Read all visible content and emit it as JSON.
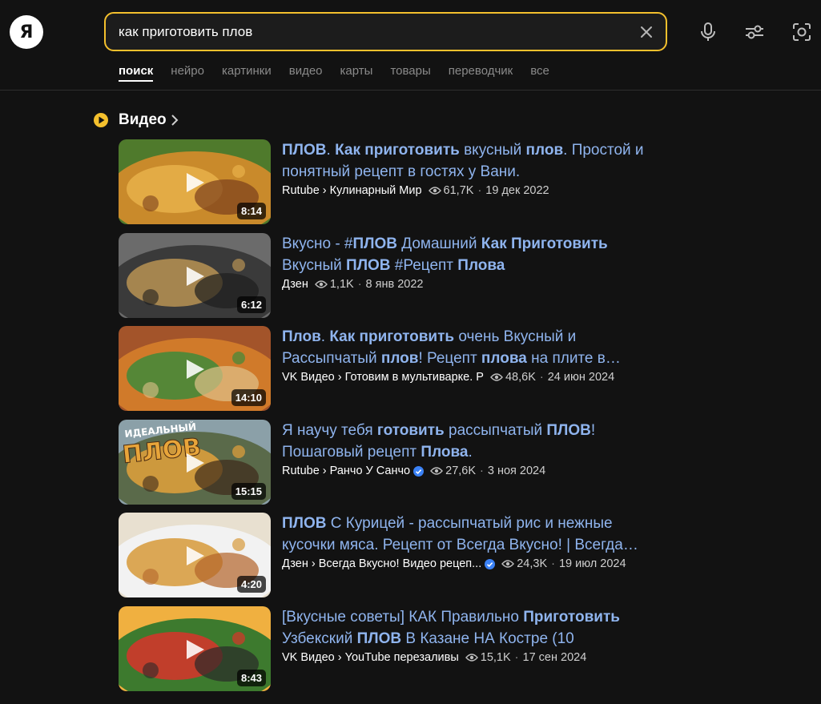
{
  "header": {
    "logo_letter": "Я",
    "search_value": "как приготовить плов"
  },
  "tabs": [
    {
      "label": "поиск",
      "active": true
    },
    {
      "label": "нейро",
      "active": false
    },
    {
      "label": "картинки",
      "active": false
    },
    {
      "label": "видео",
      "active": false
    },
    {
      "label": "карты",
      "active": false
    },
    {
      "label": "товары",
      "active": false
    },
    {
      "label": "переводчик",
      "active": false
    },
    {
      "label": "все",
      "active": false
    }
  ],
  "section": {
    "title": "Видео"
  },
  "colors": {
    "accent": "#f4c02d",
    "title_link": "#8fb4ee",
    "verified": "#3b82f6",
    "background": "#121212"
  },
  "videos": [
    {
      "title_parts": [
        {
          "t": "ПЛОВ",
          "b": true
        },
        {
          "t": ". ",
          "b": false
        },
        {
          "t": "Как приготовить",
          "b": true
        },
        {
          "t": " вкусный ",
          "b": false
        },
        {
          "t": "плов",
          "b": true
        },
        {
          "t": ". Простой и понятный рецепт в гостях у Вани.",
          "b": false
        }
      ],
      "source": "Rutube › Кулинарный Мир",
      "verified": false,
      "views": "61,7K",
      "date": "19 дек 2022",
      "duration": "8:14",
      "palette": [
        "#c98a2b",
        "#e8b04a",
        "#7a3f1c",
        "#4f7a2c"
      ]
    },
    {
      "title_parts": [
        {
          "t": "Вкусно - #",
          "b": false
        },
        {
          "t": "ПЛОВ",
          "b": true
        },
        {
          "t": " Домашний ",
          "b": false
        },
        {
          "t": "Как Приготовить",
          "b": true
        },
        {
          "t": " Вкусный ",
          "b": false
        },
        {
          "t": "ПЛОВ",
          "b": true
        },
        {
          "t": " #Рецепт ",
          "b": false
        },
        {
          "t": "Плова",
          "b": true
        }
      ],
      "source": "Дзен",
      "verified": false,
      "views": "1,1K",
      "date": "8 янв 2022",
      "duration": "6:12",
      "palette": [
        "#3a3a3a",
        "#b89354",
        "#1e1e1e",
        "#6b6b6b"
      ]
    },
    {
      "title_parts": [
        {
          "t": "Плов",
          "b": true
        },
        {
          "t": ". ",
          "b": false
        },
        {
          "t": "Как приготовить",
          "b": true
        },
        {
          "t": " очень Вкусный и Рассыпчатый ",
          "b": false
        },
        {
          "t": "плов",
          "b": true
        },
        {
          "t": "! Рецепт ",
          "b": false
        },
        {
          "t": "плова",
          "b": true
        },
        {
          "t": " на плите в мультиварке",
          "b": false
        }
      ],
      "source": "VK Видео › Готовим в мультиварке. Р",
      "verified": false,
      "views": "48,6K",
      "date": "24 июн 2024",
      "duration": "14:10",
      "palette": [
        "#d07a2a",
        "#3f8a3a",
        "#e0c28a",
        "#a3542a"
      ]
    },
    {
      "title_parts": [
        {
          "t": "Я научу тебя ",
          "b": false
        },
        {
          "t": "готовить",
          "b": true
        },
        {
          "t": " рассыпчатый ",
          "b": false
        },
        {
          "t": "ПЛОВ",
          "b": true
        },
        {
          "t": "! Пошаговый рецепт ",
          "b": false
        },
        {
          "t": "Плова",
          "b": true
        },
        {
          "t": ".",
          "b": false
        }
      ],
      "source": "Rutube › Ранчо У Санчо",
      "verified": true,
      "views": "27,6K",
      "date": "3 ноя 2024",
      "duration": "15:15",
      "palette": [
        "#5a6a4a",
        "#e2a13b",
        "#3d2a1a",
        "#8ba0a8"
      ],
      "overlay_text": [
        "ИДЕАЛЬНЫЙ",
        "ПЛОВ"
      ]
    },
    {
      "title_parts": [
        {
          "t": "ПЛОВ",
          "b": true
        },
        {
          "t": " С Курицей - рассыпчатый рис и нежные кусочки мяса. Рецепт от Всегда Вкусно! | Всегда Вкусно",
          "b": false
        }
      ],
      "source": "Дзен › Всегда Вкусно! Видео рецеп...",
      "verified": true,
      "views": "24,3K",
      "date": "19 июл 2024",
      "duration": "4:20",
      "palette": [
        "#f2f2f2",
        "#d79a3a",
        "#b3642a",
        "#e8e0d0"
      ]
    },
    {
      "title_parts": [
        {
          "t": "[Вкусные советы] КАК Правильно ",
          "b": false
        },
        {
          "t": "Приготовить",
          "b": true
        },
        {
          "t": " Узбекский ",
          "b": false
        },
        {
          "t": "ПЛОВ",
          "b": true
        },
        {
          "t": " В Казане НА Костре (10",
          "b": false
        }
      ],
      "source": "VK Видео › YouTube перезаливы",
      "verified": false,
      "views": "15,1K",
      "date": "17 сен 2024",
      "duration": "8:43",
      "palette": [
        "#3d7a2e",
        "#d8342a",
        "#2a2a2a",
        "#f0b040"
      ]
    }
  ]
}
